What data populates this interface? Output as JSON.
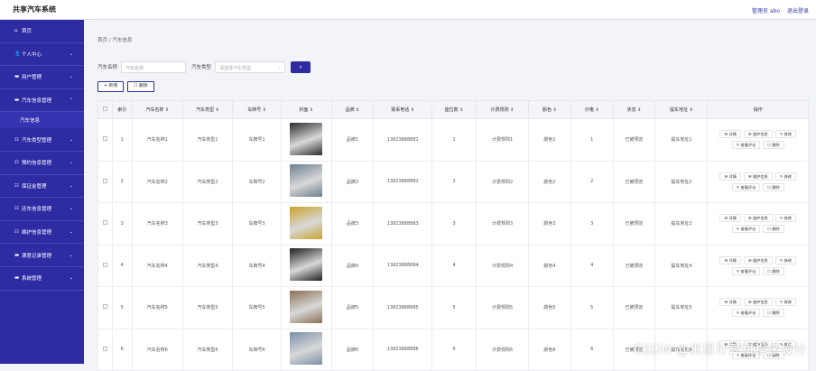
{
  "app": {
    "title": "共享汽车系统",
    "user": "管理员 abo",
    "logout": "退出登录"
  },
  "sidebar": {
    "items": [
      {
        "icon": "⌂",
        "label": "首页",
        "chevron": ""
      },
      {
        "icon": "👤",
        "label": "个人中心",
        "chevron": "⌄"
      },
      {
        "icon": "▬",
        "label": "用户管理",
        "chevron": "⌄"
      },
      {
        "icon": "▬",
        "label": "汽车信息管理",
        "chevron": "⌃"
      }
    ],
    "sub": "汽车信息",
    "items2": [
      {
        "icon": "☷",
        "label": "汽车类型管理",
        "chevron": "⌄"
      },
      {
        "icon": "☷",
        "label": "预约信息管理",
        "chevron": "⌄"
      },
      {
        "icon": "☷",
        "label": "保证金管理",
        "chevron": "⌄"
      },
      {
        "icon": "☷",
        "label": "还车信息管理",
        "chevron": "⌄"
      },
      {
        "icon": "☷",
        "label": "维护信息管理",
        "chevron": "⌄"
      },
      {
        "icon": "▬",
        "label": "满意记录管理",
        "chevron": "⌄"
      },
      {
        "icon": "▬",
        "label": "系统管理",
        "chevron": "⌄"
      }
    ]
  },
  "breadcrumb": "首页 / 汽车信息",
  "filter": {
    "name_label": "汽车名称",
    "name_placeholder": "汽车名称",
    "type_label": "汽车类型",
    "type_placeholder": "请选择汽车类型",
    "search_icon": "search-icon",
    "search_glyph": "⌕"
  },
  "actions": {
    "add": "+ 新增",
    "delete": "☐ 删除"
  },
  "table": {
    "headers": [
      "索引",
      "汽车名称 ⇕",
      "汽车类型 ⇕",
      "车牌号 ⇕",
      "封面 ⇕",
      "品牌 ⇕",
      "联系电话 ⇕",
      "座位数 ⇕",
      "计费规则 ⇕",
      "颜色 ⇕",
      "价格 ⇕",
      "状态 ⇕",
      "提车地址 ⇕",
      "操作"
    ],
    "rows": [
      {
        "idx": "1",
        "name": "汽车名称1",
        "type": "汽车类型1",
        "plate": "车牌号1",
        "brand": "品牌1",
        "phone": "13823888881",
        "seats": "1",
        "rule": "计费规则1",
        "color": "颜色1",
        "price": "1",
        "status": "已被预定",
        "addr": "提车地址1",
        "cover_color": "#2b2b2b"
      },
      {
        "idx": "2",
        "name": "汽车名称2",
        "type": "汽车类型2",
        "plate": "车牌号2",
        "brand": "品牌2",
        "phone": "13823888882",
        "seats": "2",
        "rule": "计费规则2",
        "color": "颜色2",
        "price": "2",
        "status": "已被预定",
        "addr": "提车地址2",
        "cover_color": "#6b7f8f"
      },
      {
        "idx": "3",
        "name": "汽车名称3",
        "type": "汽车类型3",
        "plate": "车牌号3",
        "brand": "品牌3",
        "phone": "13823888883",
        "seats": "3",
        "rule": "计费规则3",
        "color": "颜色3",
        "price": "3",
        "status": "已被预定",
        "addr": "提车地址3",
        "cover_color": "#c9a22a"
      },
      {
        "idx": "4",
        "name": "汽车名称4",
        "type": "汽车类型4",
        "plate": "车牌号4",
        "brand": "品牌4",
        "phone": "13823888884",
        "seats": "4",
        "rule": "计费规则4",
        "color": "颜色4",
        "price": "4",
        "status": "已被预定",
        "addr": "提车地址4",
        "cover_color": "#1e1e22"
      },
      {
        "idx": "5",
        "name": "汽车名称5",
        "type": "汽车类型5",
        "plate": "车牌号5",
        "brand": "品牌5",
        "phone": "13823888885",
        "seats": "5",
        "rule": "计费规则5",
        "color": "颜色5",
        "price": "5",
        "status": "已被预定",
        "addr": "提车地址5",
        "cover_color": "#8a6f55"
      },
      {
        "idx": "6",
        "name": "汽车名称6",
        "type": "汽车类型6",
        "plate": "车牌号6",
        "brand": "品牌6",
        "phone": "13823888886",
        "seats": "6",
        "rule": "计费规则6",
        "color": "颜色6",
        "price": "6",
        "status": "已被预定",
        "addr": "提车地址6",
        "cover_color": "#7a8fa8"
      }
    ],
    "ops": [
      "☰ 详情",
      "☰ 维护信息",
      "✎ 修改",
      "✎ 查看评论",
      "☐ 删除"
    ]
  },
  "watermark": "CSDN @米恩计算机程序设计"
}
